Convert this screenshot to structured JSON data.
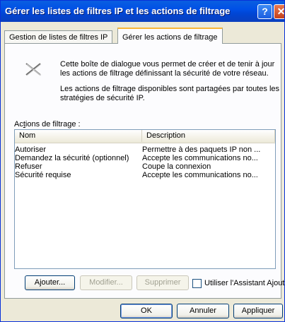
{
  "window": {
    "title": "Gérer les listes de filtres IP et les actions de filtrage",
    "help_glyph": "?",
    "close_glyph": "✕"
  },
  "tabs": [
    {
      "label": "Gestion de listes de filtres IP",
      "active": false
    },
    {
      "label": "Gérer les actions de filtrage",
      "active": true
    }
  ],
  "description": {
    "icon": "filter-actions-icon",
    "line1": "Cette boîte de dialogue vous permet de créer et de tenir à jour les actions de filtrage définissant la sécurité de votre réseau.",
    "line2": "Les actions de filtrage disponibles sont partagées par toutes les stratégies de sécurité IP."
  },
  "list": {
    "label": "Actions de filtrage :",
    "columns": [
      "Nom",
      "Description"
    ],
    "rows": [
      {
        "name": "Autoriser",
        "description": "Permettre à des paquets IP non ..."
      },
      {
        "name": "Demandez la sécurité (optionnel)",
        "description": "Accepte les communications no..."
      },
      {
        "name": "Refuser",
        "description": "Coupe la connexion"
      },
      {
        "name": "Sécurité requise",
        "description": "Accepte les communications no..."
      }
    ]
  },
  "actions": {
    "add": "Ajouter...",
    "edit": "Modifier...",
    "remove": "Supprimer",
    "wizard_checkbox": "Utiliser l'Assistant Ajout",
    "wizard_checked": false
  },
  "footer": {
    "ok": "OK",
    "cancel": "Annuler",
    "apply": "Appliquer"
  },
  "colors": {
    "titlebar": "#0050e6",
    "dialog_bg": "#ece9d8",
    "active_tab_accent": "#f8b536"
  }
}
